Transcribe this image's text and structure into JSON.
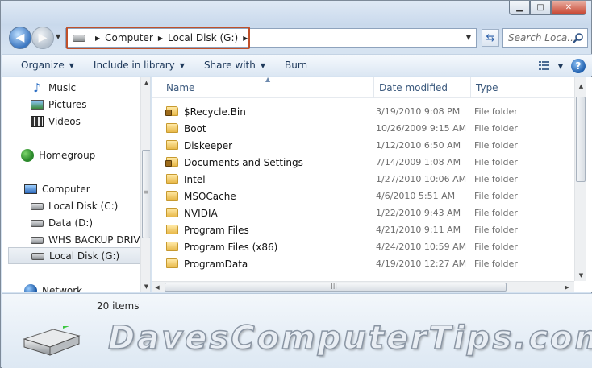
{
  "address": {
    "crumbs": [
      "Computer",
      "Local Disk (G:)"
    ]
  },
  "search": {
    "placeholder": "Search Loca..."
  },
  "commands": {
    "organize": "Organize",
    "include": "Include in library",
    "share": "Share with",
    "burn": "Burn"
  },
  "nav": {
    "items": [
      {
        "label": "Music",
        "icon": "music-icon"
      },
      {
        "label": "Pictures",
        "icon": "pictures-icon"
      },
      {
        "label": "Videos",
        "icon": "videos-icon"
      },
      {
        "label": "Homegroup",
        "icon": "homegroup-icon"
      },
      {
        "label": "Computer",
        "icon": "computer-icon"
      },
      {
        "label": "Local Disk (C:)",
        "icon": "drive-icon"
      },
      {
        "label": "Data (D:)",
        "icon": "drive-icon"
      },
      {
        "label": "WHS BACKUP DRIVE",
        "icon": "drive-icon"
      },
      {
        "label": "Local Disk (G:)",
        "icon": "drive-icon"
      },
      {
        "label": "Network",
        "icon": "network-icon"
      }
    ]
  },
  "columns": {
    "name": "Name",
    "date": "Date modified",
    "type": "Type"
  },
  "files": [
    {
      "name": "$Recycle.Bin",
      "date": "3/19/2010 9:08 PM",
      "type": "File folder",
      "locked": true
    },
    {
      "name": "Boot",
      "date": "10/26/2009 9:15 AM",
      "type": "File folder",
      "locked": false
    },
    {
      "name": "Diskeeper",
      "date": "1/12/2010 6:50 AM",
      "type": "File folder",
      "locked": false
    },
    {
      "name": "Documents and Settings",
      "date": "7/14/2009 1:08 AM",
      "type": "File folder",
      "locked": true
    },
    {
      "name": "Intel",
      "date": "1/27/2010 10:06 AM",
      "type": "File folder",
      "locked": false
    },
    {
      "name": "MSOCache",
      "date": "4/6/2010 5:51 AM",
      "type": "File folder",
      "locked": false
    },
    {
      "name": "NVIDIA",
      "date": "1/22/2010 9:43 AM",
      "type": "File folder",
      "locked": false
    },
    {
      "name": "Program Files",
      "date": "4/21/2010 9:11 AM",
      "type": "File folder",
      "locked": false
    },
    {
      "name": "Program Files (x86)",
      "date": "4/24/2010 10:59 AM",
      "type": "File folder",
      "locked": false
    },
    {
      "name": "ProgramData",
      "date": "4/19/2010 12:27 AM",
      "type": "File folder",
      "locked": false
    }
  ],
  "status": {
    "count": "20 items"
  },
  "watermark": "DavesComputerTips.com",
  "colors": {
    "accent": "#c0502a",
    "chrome": "#dce7f3",
    "link": "#1e395b"
  }
}
